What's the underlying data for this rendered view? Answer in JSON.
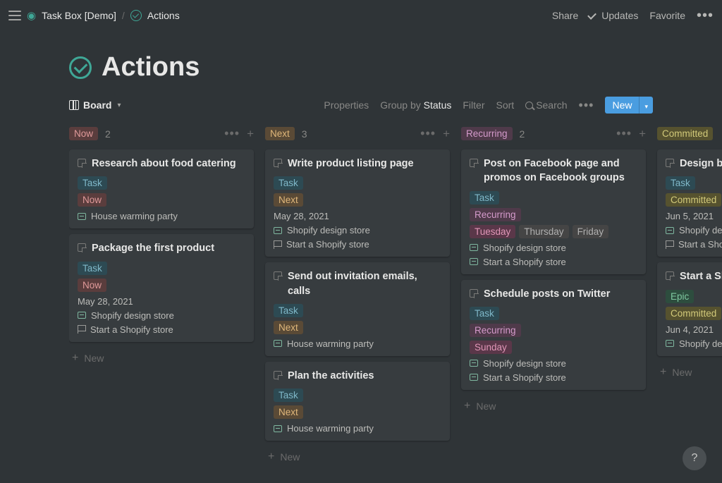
{
  "breadcrumb": {
    "workspace": "Task Box [Demo]",
    "page": "Actions"
  },
  "topbar": {
    "share": "Share",
    "updates": "Updates",
    "favorite": "Favorite"
  },
  "title": "Actions",
  "toolbar": {
    "view": "Board",
    "properties": "Properties",
    "groupby_prefix": "Group by",
    "groupby_value": "Status",
    "filter": "Filter",
    "sort": "Sort",
    "search": "Search",
    "new": "New"
  },
  "new_label": "New",
  "columns": [
    {
      "name": "Now",
      "badge_class": "badge-now",
      "count": "2",
      "cards": [
        {
          "title": "Research about food catering",
          "badges": [
            {
              "text": "Task",
              "class": "badge-task"
            },
            {
              "text": "Now",
              "class": "badge-now"
            }
          ],
          "links": [
            {
              "type": "proj",
              "text": "House warming party"
            }
          ]
        },
        {
          "title": "Package the first product",
          "badges": [
            {
              "text": "Task",
              "class": "badge-task"
            },
            {
              "text": "Now",
              "class": "badge-now"
            }
          ],
          "date": "May 28, 2021",
          "links": [
            {
              "type": "proj",
              "text": "Shopify design store"
            },
            {
              "type": "flag",
              "text": "Start a Shopify store"
            }
          ]
        }
      ]
    },
    {
      "name": "Next",
      "badge_class": "badge-next",
      "count": "3",
      "cards": [
        {
          "title": "Write product listing page",
          "badges": [
            {
              "text": "Task",
              "class": "badge-task"
            },
            {
              "text": "Next",
              "class": "badge-next"
            }
          ],
          "date": "May 28, 2021",
          "links": [
            {
              "type": "proj",
              "text": "Shopify design store"
            },
            {
              "type": "flag",
              "text": "Start a Shopify store"
            }
          ]
        },
        {
          "title": "Send out invitation emails, calls",
          "badges": [
            {
              "text": "Task",
              "class": "badge-task"
            },
            {
              "text": "Next",
              "class": "badge-next"
            }
          ],
          "links": [
            {
              "type": "proj",
              "text": "House warming party"
            }
          ]
        },
        {
          "title": "Plan the activities",
          "badges": [
            {
              "text": "Task",
              "class": "badge-task"
            },
            {
              "text": "Next",
              "class": "badge-next"
            }
          ],
          "links": [
            {
              "type": "proj",
              "text": "House warming party"
            }
          ]
        }
      ]
    },
    {
      "name": "Recurring",
      "badge_class": "badge-recurring",
      "count": "2",
      "cards": [
        {
          "title": "Post on Facebook page and promos on Facebook groups",
          "badges": [
            {
              "text": "Task",
              "class": "badge-task"
            },
            {
              "text": "Recurring",
              "class": "badge-recurring"
            }
          ],
          "day_badges": [
            {
              "text": "Tuesday",
              "class": "badge-day-pink"
            },
            {
              "text": "Thursday",
              "class": "badge-day-gray"
            },
            {
              "text": "Friday",
              "class": "badge-day-gray"
            }
          ],
          "links": [
            {
              "type": "proj",
              "text": "Shopify design store"
            },
            {
              "type": "proj",
              "text": "Start a Shopify store"
            }
          ]
        },
        {
          "title": "Schedule posts on Twitter",
          "badges": [
            {
              "text": "Task",
              "class": "badge-task"
            },
            {
              "text": "Recurring",
              "class": "badge-recurring"
            },
            {
              "text": "Sunday",
              "class": "badge-sunday"
            }
          ],
          "links": [
            {
              "type": "proj",
              "text": "Shopify design store"
            },
            {
              "type": "proj",
              "text": "Start a Shopify store"
            }
          ]
        }
      ]
    },
    {
      "name": "Committed",
      "badge_class": "badge-committed",
      "count": "",
      "cards": [
        {
          "title": "Design bra",
          "badges": [
            {
              "text": "Task",
              "class": "badge-task"
            },
            {
              "text": "Committed",
              "class": "badge-committed"
            }
          ],
          "date": "Jun 5, 2021",
          "links": [
            {
              "type": "proj",
              "text": "Shopify des"
            },
            {
              "type": "flag",
              "text": "Start a Sho"
            }
          ]
        },
        {
          "title": "Start a Sho",
          "badges": [
            {
              "text": "Epic",
              "class": "badge-epic"
            },
            {
              "text": "Committed",
              "class": "badge-committed"
            }
          ],
          "date": "Jun 4, 2021",
          "links": [
            {
              "type": "proj",
              "text": "Shopify des"
            }
          ]
        }
      ]
    }
  ]
}
